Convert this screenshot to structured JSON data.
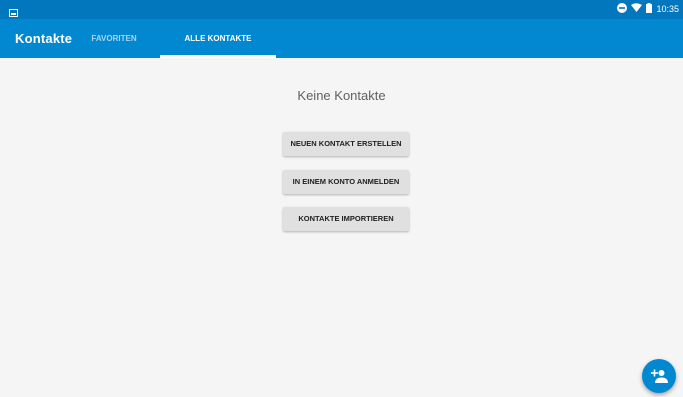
{
  "status_bar": {
    "time": "10:35",
    "icons": [
      "screenshot-notification-icon",
      "do-not-disturb-icon",
      "wifi-icon",
      "battery-icon"
    ]
  },
  "app_bar": {
    "title": "Kontakte",
    "tabs": [
      {
        "label": "FAVORITEN",
        "selected": false
      },
      {
        "label": "ALLE KONTAKTE",
        "selected": true
      }
    ]
  },
  "main": {
    "empty_message": "Keine Kontakte",
    "buttons": [
      {
        "label": "NEUEN KONTAKT ERSTELLEN"
      },
      {
        "label": "IN EINEM KONTO ANMELDEN"
      },
      {
        "label": "KONTAKTE IMPORTIEREN"
      }
    ]
  },
  "fab": {
    "icon": "add-contact-icon"
  },
  "colors": {
    "status_bar": "#0277bd",
    "app_bar": "#0288d1",
    "background": "#f5f5f5",
    "button": "#e0e0e0",
    "fab": "#0288d1"
  }
}
